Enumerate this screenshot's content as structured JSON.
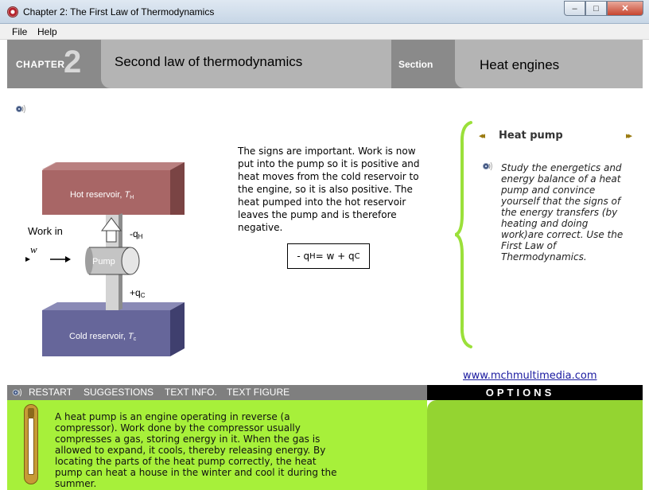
{
  "window": {
    "title": "Chapter 2: The First Law of Thermodynamics",
    "min_symbol": "–",
    "max_symbol": "□",
    "close_symbol": "✕"
  },
  "menu": {
    "file": "File",
    "help": "Help"
  },
  "header": {
    "chapter_label": "CHAPTER",
    "chapter_number": "2",
    "title": "Second law of thermodynamics",
    "section_label": "Section",
    "section_title": "Heat engines"
  },
  "figure": {
    "hot_reservoir_label": "Hot reservoir, ",
    "hot_reservoir_symbol": "T",
    "hot_reservoir_sub": "H",
    "cold_reservoir_label": "Cold reservoir, ",
    "cold_reservoir_symbol": "T",
    "cold_reservoir_sub": "c",
    "work_label": "Work in",
    "work_symbol": "w",
    "pump_label": "Pump",
    "qh_label": "-q",
    "qh_sub": "H",
    "qc_label": "+q",
    "qc_sub": "C"
  },
  "main_text": "The signs are important.  Work is now put into the pump so it is positive and heat moves from the cold reservoir to the engine, so it is also positive.  The heat pumped into the hot reservoir leaves the pump and is therefore negative.",
  "formula": {
    "lhs": "- q",
    "lhs_sub": "H",
    "mid": " = w + q",
    "rhs_sub": "C"
  },
  "side_panel": {
    "title": "Heat pump",
    "prev_symbol": "◂◂",
    "next_symbol": "▸▸",
    "text": "Study the energetics and energy balance of a heat pump and convince yourself that the signs of the energy transfers (by heating and doing work)are correct.  Use the First Law of Thermodynamics."
  },
  "link": "www.mchmultimedia.com",
  "toolbar": {
    "restart": "RESTART",
    "suggestions": "SUGGESTIONS",
    "text_info": "TEXT INFO.",
    "text_figure": "TEXT FIGURE",
    "options": "OPTIONS"
  },
  "info_text": "A heat pump is an engine operating in reverse (a compressor).  Work done by the compressor usually compresses a gas, storing energy in it.  When the gas is allowed to expand, it cools, thereby releasing energy.  By locating the parts of the heat pump correctly, the heat pump can heat a house in the winter and cool it during the summer.",
  "colors": {
    "hot_reservoir": "#a86666",
    "cold_reservoir": "#66669a",
    "header_gray": "#8a8a8a",
    "panel_green": "#a7f03a",
    "brace_green": "#9be03a"
  }
}
